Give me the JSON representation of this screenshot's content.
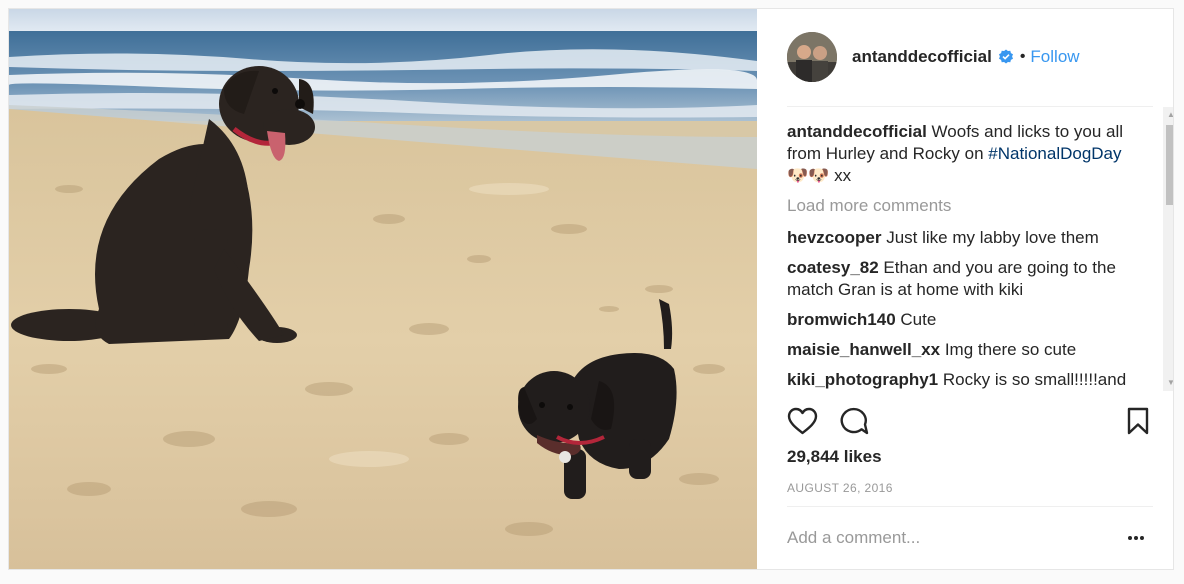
{
  "post": {
    "username": "antanddecofficial",
    "follow_label": "Follow",
    "dot": "•",
    "caption": {
      "username": "antanddecofficial",
      "text": "Woofs and licks to you all from Hurley and Rocky on",
      "hashtag": "#NationalDogDay",
      "emoji": "🐶🐶",
      "suffix": "xx"
    },
    "load_more": "Load more comments",
    "comments": [
      {
        "user": "hevzcooper",
        "text": "Just like my labby love them"
      },
      {
        "user": "coatesy_82",
        "text": "Ethan and you are going to the match Gran is at home with kiki"
      },
      {
        "user": "bromwich140",
        "text": "Cute"
      },
      {
        "user": "maisie_hanwell_xx",
        "text": "Img there so cute"
      },
      {
        "user": "kiki_photography1",
        "text": "Rocky is so small!!!!!and"
      }
    ],
    "likes": "29,844 likes",
    "date": "AUGUST 26, 2016",
    "add_comment_placeholder": "Add a comment...",
    "icons": [
      "heart-icon",
      "comment-icon",
      "bookmark-icon",
      "more-options-icon",
      "verified-badge-icon"
    ],
    "colors": {
      "link": "#3897f0",
      "hashtag": "#003569",
      "muted": "#999999",
      "text": "#262626"
    }
  }
}
